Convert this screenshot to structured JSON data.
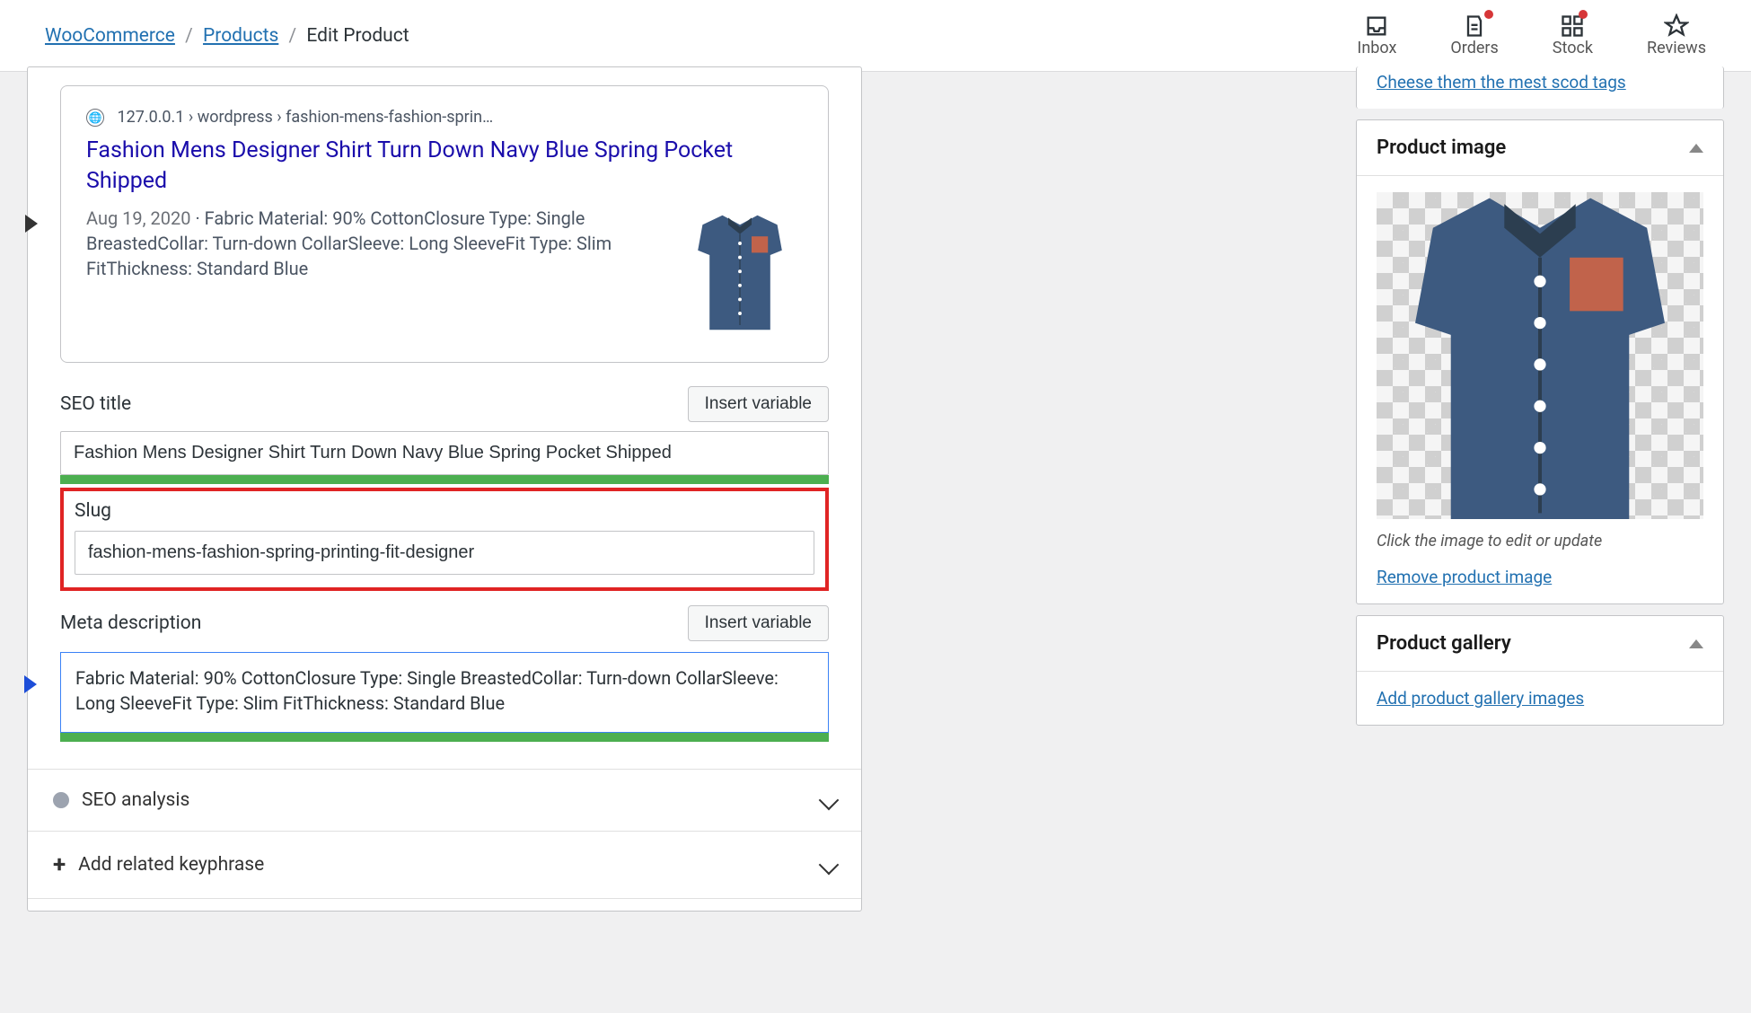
{
  "breadcrumb": {
    "root": "WooCommerce",
    "section": "Products",
    "current": "Edit Product"
  },
  "topnav": {
    "inbox": "Inbox",
    "orders": "Orders",
    "stock": "Stock",
    "reviews": "Reviews"
  },
  "sidebar": {
    "truncated_link": "Cheese them the mest scod tags",
    "image_panel_title": "Product image",
    "image_caption": "Click the image to edit or update",
    "remove_image": "Remove product image",
    "gallery_panel_title": "Product gallery",
    "add_gallery": "Add product gallery images"
  },
  "snippet": {
    "path": "127.0.0.1 › wordpress › fashion-mens-fashion-sprin…",
    "title": "Fashion Mens Designer Shirt Turn Down Navy Blue Spring Pocket Shipped",
    "date": "Aug 19, 2020",
    "desc": "Fabric Material: 90% CottonClosure Type: Single BreastedCollar: Turn-down CollarSleeve: Long SleeveFit Type: Slim FitThickness: Standard Blue"
  },
  "seo": {
    "title_label": "SEO title",
    "insert_variable": "Insert variable",
    "title_value": "Fashion Mens Designer Shirt Turn Down Navy Blue Spring Pocket Shipped",
    "slug_label": "Slug",
    "slug_value": "fashion-mens-fashion-spring-printing-fit-designer",
    "meta_label": "Meta description",
    "meta_value": "Fabric Material: 90% CottonClosure Type: Single BreastedCollar: Turn-down CollarSleeve: Long SleeveFit Type: Slim FitThickness: Standard Blue"
  },
  "accordions": {
    "seo_analysis": "SEO analysis",
    "add_keyphrase": "Add related keyphrase"
  }
}
